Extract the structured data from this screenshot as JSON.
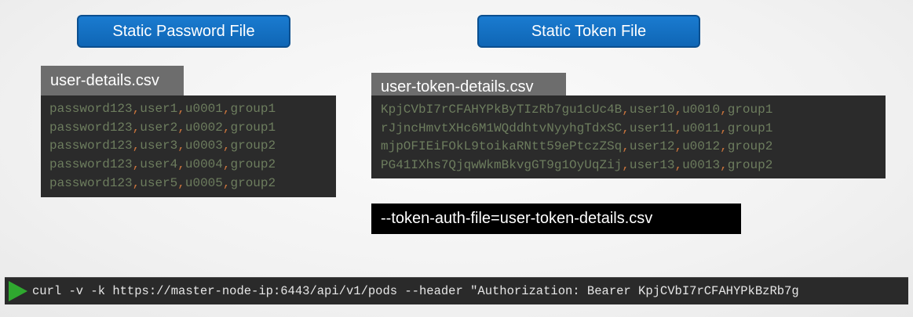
{
  "headers": {
    "password_file": "Static Password File",
    "token_file": "Static Token File"
  },
  "password_csv": {
    "filename": "user-details.csv",
    "rows": [
      [
        "password123",
        "user1",
        "u0001",
        "group1"
      ],
      [
        "password123",
        "user2",
        "u0002",
        "group1"
      ],
      [
        "password123",
        "user3",
        "u0003",
        "group2"
      ],
      [
        "password123",
        "user4",
        "u0004",
        "group2"
      ],
      [
        "password123",
        "user5",
        "u0005",
        "group2"
      ]
    ]
  },
  "token_csv": {
    "filename": "user-token-details.csv",
    "rows": [
      [
        "KpjCVbI7rCFAHYPkByTIzRb7gu1cUc4B",
        "user10",
        "u0010",
        "group1"
      ],
      [
        "rJjncHmvtXHc6M1WQddhtvNyyhgTdxSC",
        "user11",
        "u0011",
        "group1"
      ],
      [
        "mjpOFIEiFOkL9toikaRNtt59ePtczZSq",
        "user12",
        "u0012",
        "group2"
      ],
      [
        "PG41IXhs7QjqwWkmBkvgGT9g1OyUqZij",
        "user13",
        "u0013",
        "group2"
      ]
    ]
  },
  "flag": "--token-auth-file=user-token-details.csv",
  "terminal": {
    "command": "curl -v -k https://master-node-ip:6443/api/v1/pods --header \"Authorization: Bearer KpjCVbI7rCFAHYPkBzRb7g"
  },
  "colors": {
    "pill_blue": "#1a7bd0",
    "code_bg": "#2b2b2b",
    "value_green": "#6d7d5e",
    "comma_orange": "#c7733c",
    "run_green": "#2fa82f"
  }
}
